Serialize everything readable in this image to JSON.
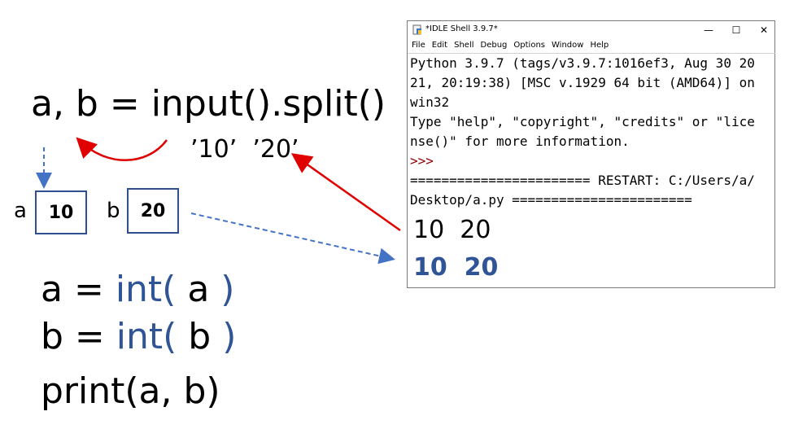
{
  "left": {
    "split_line": "a, b = input().split()",
    "strings": "’10’  ’20’",
    "var_a": {
      "label": "a",
      "value": "10"
    },
    "var_b": {
      "label": "b",
      "value": "20"
    },
    "code": [
      {
        "prefix": "a = ",
        "func": "int(",
        "arg": " a ",
        "close": ")"
      },
      {
        "prefix": "b = ",
        "func": "int(",
        "arg": " b ",
        "close": ")"
      }
    ],
    "print_line": "print(a, b)"
  },
  "idle": {
    "title": "*IDLE Shell 3.9.7*",
    "controls": {
      "minimize": "—",
      "maximize": "☐",
      "close": "✕"
    },
    "menu": [
      "File",
      "Edit",
      "Shell",
      "Debug",
      "Options",
      "Window",
      "Help"
    ],
    "lines": [
      "Python 3.9.7 (tags/v3.9.7:1016ef3, Aug 30 20",
      "21, 20:19:38) [MSC v.1929 64 bit (AMD64)] on",
      "win32",
      "Type \"help\", \"copyright\", \"credits\" or \"lice",
      "nse()\" for more information."
    ],
    "prompt": ">>>",
    "restart_1": "======================= RESTART: C:/Users/a/",
    "restart_2": "Desktop/a.py =======================",
    "output_input": "10  20",
    "output_result": "10  20"
  },
  "colors": {
    "accent_blue": "#2F5597",
    "arrow_red": "#E00000",
    "prompt_red": "#8b0000"
  }
}
